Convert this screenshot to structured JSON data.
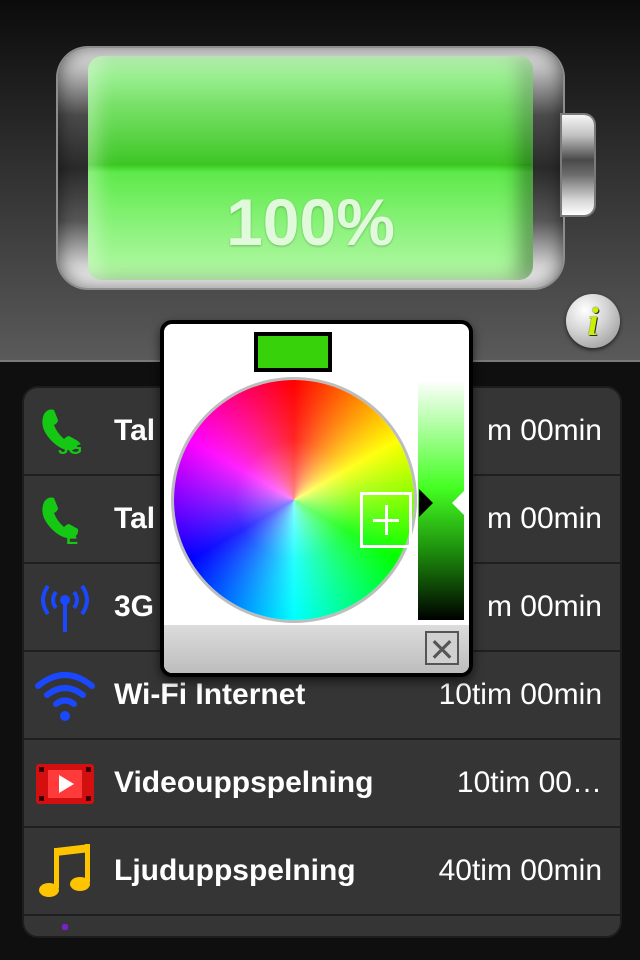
{
  "battery": {
    "percent_label": "100%",
    "level": 1.0,
    "fill_color": "#45d530"
  },
  "info_button": {
    "icon": "info-icon",
    "glyph": "i"
  },
  "rows": [
    {
      "icon": "phone-3g-icon",
      "label": "Tal",
      "value": "m 00min"
    },
    {
      "icon": "phone-edge-icon",
      "label": "Tal",
      "value": "m 00min"
    },
    {
      "icon": "antenna-icon",
      "label": "3G",
      "value": "m 00min"
    },
    {
      "icon": "wifi-icon",
      "label": "Wi-Fi Internet",
      "value": "10tim 00min"
    },
    {
      "icon": "video-icon",
      "label": "Videouppspelning",
      "value": "10tim 00…"
    },
    {
      "icon": "music-note-icon",
      "label": "Ljuduppspelning",
      "value": "40tim 00min"
    }
  ],
  "color_picker": {
    "selected_color": "#38d20a",
    "close_glyph": "✕",
    "close_icon": "close-icon"
  }
}
